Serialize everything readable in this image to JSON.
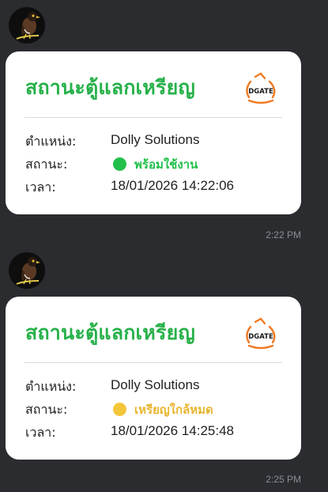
{
  "messages": [
    {
      "card": {
        "title": "สถานะตู้แลกเหรียญ",
        "logo_text": "DGATE",
        "rows": [
          {
            "label": "ตำแหน่ง:",
            "value": "Dolly Solutions"
          },
          {
            "label": "สถานะ:",
            "value": "พร้อมใช้งาน",
            "status_color": "#22c04a"
          },
          {
            "label": "เวลา:",
            "value": "18/01/2026 14:22:06"
          }
        ]
      },
      "time": "2:22 PM"
    },
    {
      "card": {
        "title": "สถานะตู้แลกเหรียญ",
        "logo_text": "DGATE",
        "rows": [
          {
            "label": "ตำแหน่ง:",
            "value": "Dolly Solutions"
          },
          {
            "label": "สถานะ:",
            "value": "เหรียญใกล้หมด",
            "status_color": "#f3c63a"
          },
          {
            "label": "เวลา:",
            "value": "18/01/2026 14:25:48"
          }
        ]
      },
      "time": "2:25 PM"
    }
  ],
  "colors": {
    "background": "#2b2c30",
    "title_green": "#27b14a",
    "ready_green": "#22c04a",
    "low_yellow_text": "#e8b530",
    "timestamp": "#8b8d92",
    "logo_orange": "#f07a22"
  },
  "icons": {
    "avatar": "bird-avatar-icon",
    "logo": "dgate-logo-icon",
    "status": "status-dot-icon"
  }
}
